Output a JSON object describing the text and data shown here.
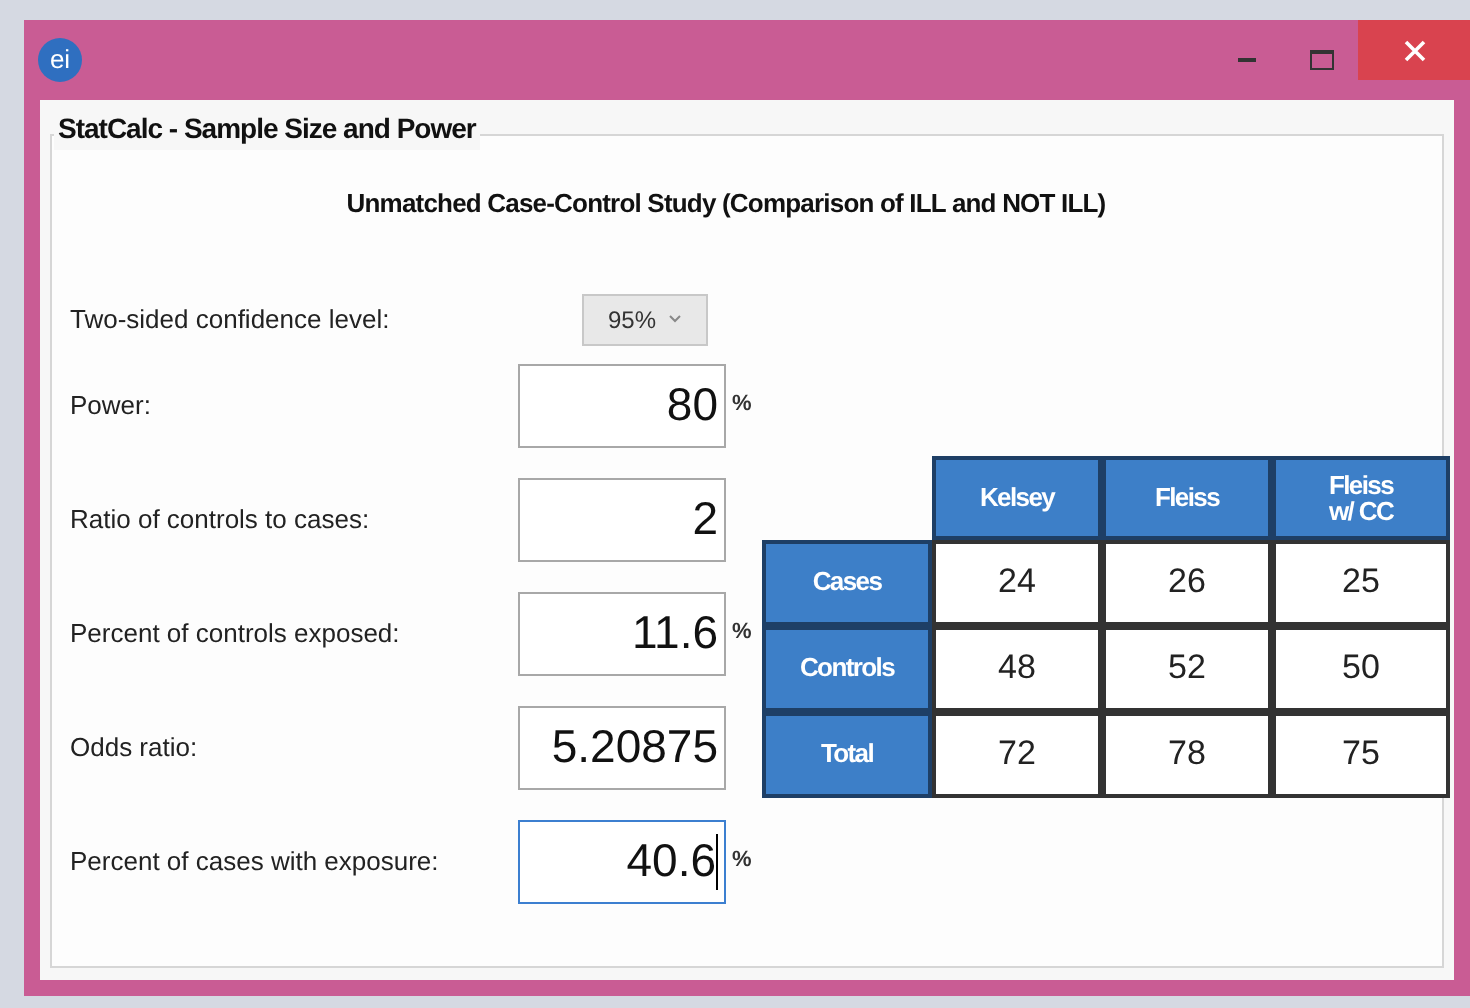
{
  "window": {
    "app_icon": "ei",
    "group_title": "StatCalc - Sample Size and Power"
  },
  "heading": "Unmatched Case-Control Study (Comparison of ILL and NOT ILL)",
  "confidence": {
    "label": "Two-sided confidence level:",
    "value": "95%"
  },
  "fields": [
    {
      "label": "Power:",
      "value": "80",
      "unit": "%",
      "focused": false
    },
    {
      "label": "Ratio of controls to cases:",
      "value": "2",
      "focused": false
    },
    {
      "label": "Percent of controls exposed:",
      "value": "11.6",
      "unit": "%",
      "focused": false
    },
    {
      "label": "Odds ratio:",
      "value": "5.20875",
      "focused": false
    },
    {
      "label": "Percent of cases with exposure:",
      "value": "40.6",
      "unit": "%",
      "focused": true
    }
  ],
  "table": {
    "columns": [
      "Kelsey",
      "Fleiss",
      "Fleiss w/ CC"
    ],
    "rows": [
      {
        "label": "Cases",
        "cells": [
          "24",
          "26",
          "25"
        ]
      },
      {
        "label": "Controls",
        "cells": [
          "48",
          "52",
          "50"
        ]
      },
      {
        "label": "Total",
        "cells": [
          "72",
          "78",
          "75"
        ]
      }
    ]
  }
}
